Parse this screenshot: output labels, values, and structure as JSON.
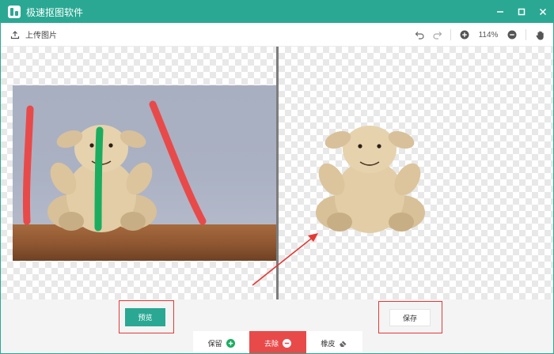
{
  "window": {
    "title": "极速抠图软件",
    "controls": [
      "minimize-icon",
      "maximize-icon",
      "close-icon"
    ]
  },
  "toolbar": {
    "upload_label": "上传图片",
    "upload_icon": "upload-icon",
    "tools": [
      "undo-icon",
      "redo-icon",
      "zoom-in-icon",
      "zoom-out-icon",
      "hand-icon"
    ],
    "zoom_level": "114%"
  },
  "bottom": {
    "preview_label": "预览",
    "save_label": "保存",
    "modes": [
      {
        "label": "保留",
        "icon": "plus-circle-icon",
        "active": false
      },
      {
        "label": "去除",
        "icon": "minus-circle-icon",
        "active": true
      },
      {
        "label": "橡皮",
        "icon": "eraser-icon",
        "active": false
      }
    ]
  },
  "colors": {
    "brand": "#2aa893",
    "remove_stroke": "#e84a4a",
    "keep_stroke": "#1aad5f",
    "active_mode": "#e84a4a",
    "highlight": "#e53935"
  }
}
